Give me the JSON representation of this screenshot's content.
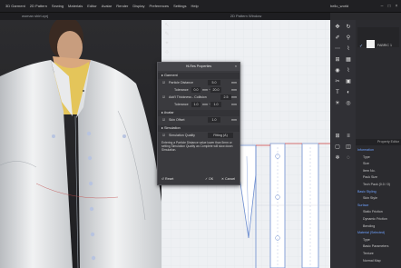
{
  "menubar": {
    "items": [
      "3D Garment",
      "2D Pattern",
      "Sewing",
      "Materials",
      "Editor",
      "Avatar",
      "Render",
      "Display",
      "Preferences",
      "Settings",
      "Help"
    ],
    "account": "hello_world"
  },
  "tabs": {
    "view3d": "woman shirt.zprj",
    "view2d": "2D Pattern Window"
  },
  "dialog": {
    "title": "Hi-Res Properties",
    "garment_title": "Garment",
    "particle_label": "Particle Distance",
    "particle_value": "5.0",
    "particle_unit": "mm",
    "tolerance_label": "Tolerance",
    "tolerance_value": "0.0",
    "tolerance_mid": "mm ~",
    "tolerance_value2": "20.0",
    "tolerance_unit": "mm",
    "avatar_thick_label": "Add'l Thickness - Collision",
    "avatar_thick_value": "2.5",
    "avatar_thick_unit": "mm",
    "tolerance2_label": "Tolerance",
    "tolerance2_value": "1.0",
    "tolerance2_mid": "mm ~",
    "tolerance2_value2": "1.0",
    "tolerance2_unit": "mm",
    "avatar_title": "Avatar",
    "skin_label": "Skin Offset",
    "skin_value": "1.0",
    "skin_unit": "mm",
    "simulation_title": "Simulation",
    "sim_quality_label": "Simulation Quality",
    "sim_quality_value": "Fitting (A)",
    "note": "Entering a Particle Distance value lower than 5mm or setting Simulation Quality as Complete will slow down Simulation.",
    "reset": "Reset",
    "ok": "OK",
    "cancel": "Cancel"
  },
  "right_panel": {
    "object_title": "FABRIC 1",
    "prop_header": "Property Editor",
    "rows": [
      {
        "label": "Information",
        "hl": true
      },
      {
        "label": "Type",
        "hl": false
      },
      {
        "label": "Size",
        "hl": false
      },
      {
        "label": "Item No.",
        "hl": false
      },
      {
        "label": "Pack Size",
        "hl": false
      },
      {
        "label": "Tech Pack (0.0 / 0)",
        "hl": false
      },
      {
        "label": "Basic Styling",
        "hl": true
      },
      {
        "label": "Skin Style",
        "hl": false
      },
      {
        "label": "Surface",
        "hl": true
      },
      {
        "label": "Static Friction",
        "hl": false
      },
      {
        "label": "Dynamic Friction",
        "hl": false
      },
      {
        "label": "Bending",
        "hl": false
      },
      {
        "label": "Material (Selected)",
        "hl": true
      },
      {
        "label": "Type",
        "hl": false
      },
      {
        "label": "Basic Parameters",
        "hl": false
      },
      {
        "label": "Texture",
        "hl": false
      },
      {
        "label": "Normal Map",
        "hl": false
      }
    ]
  }
}
